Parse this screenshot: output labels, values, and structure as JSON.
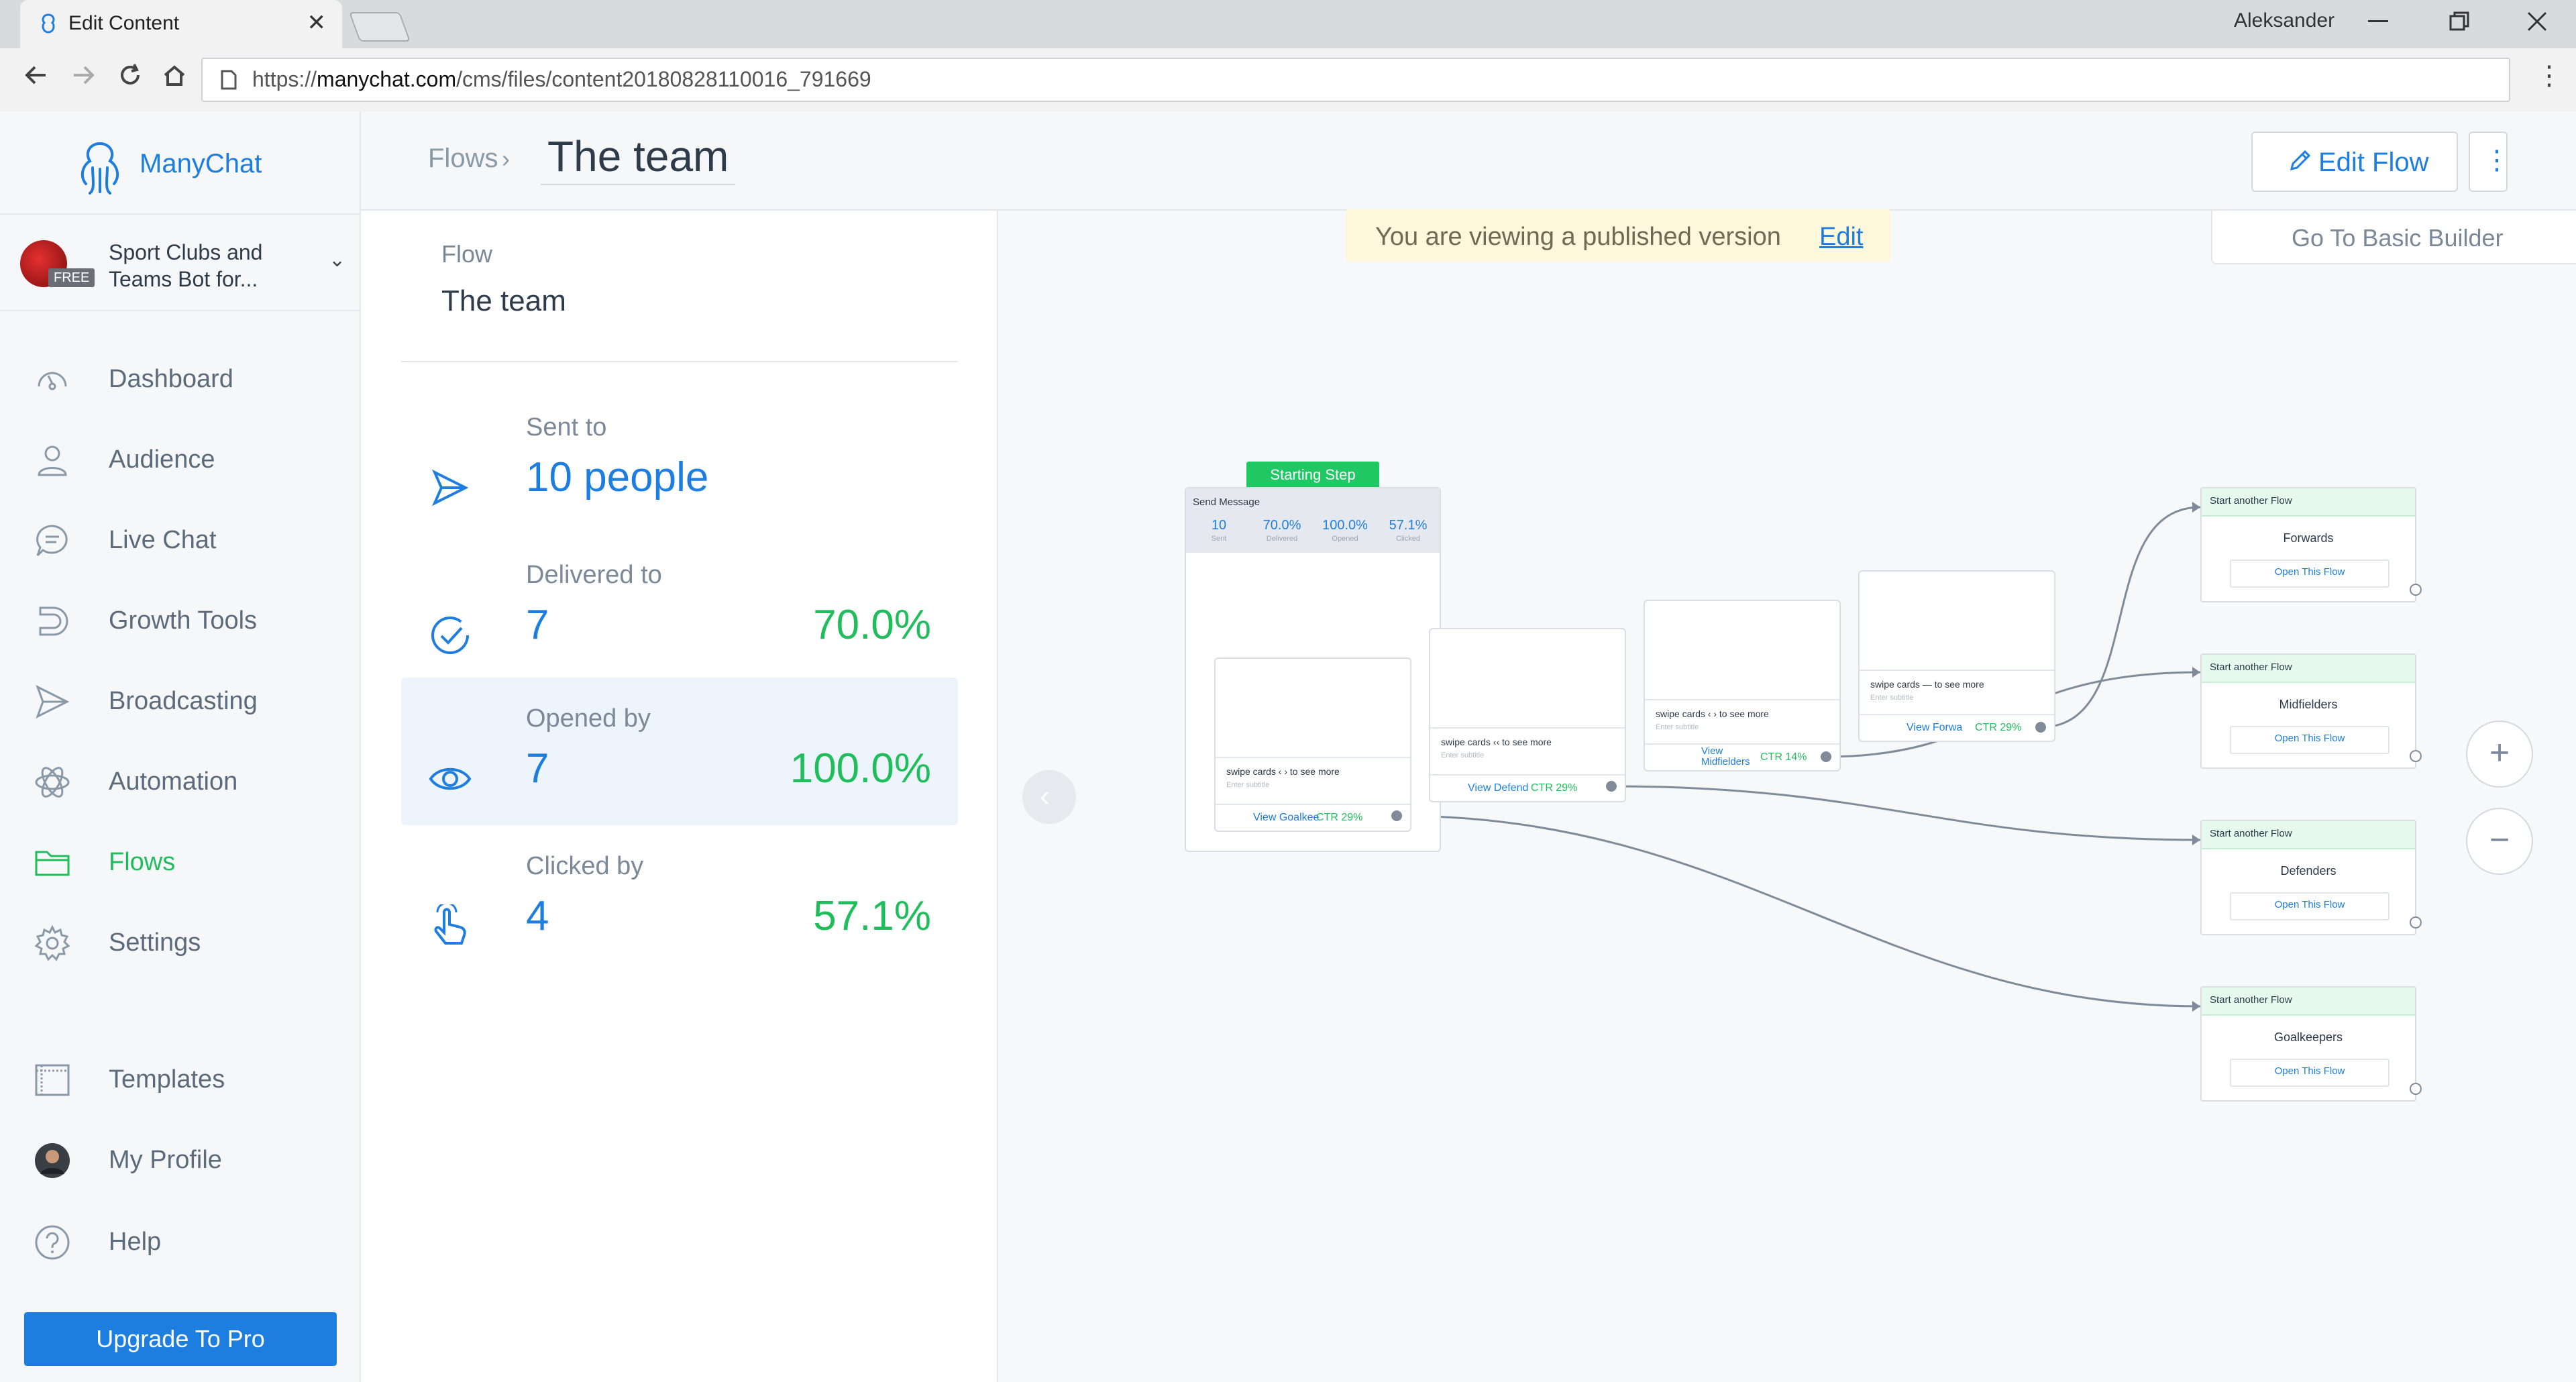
{
  "browser": {
    "tab_title": "Edit Content",
    "tab_close": "✕",
    "user": "Aleksander",
    "url_prefix": "https://",
    "url_host": "manychat.com",
    "url_path": "/cms/files/content20180828110016_791669"
  },
  "app": {
    "logo_text": "ManyChat",
    "breadcrumb": "Flows",
    "title": "The team",
    "edit_flow_label": "Edit Flow",
    "kebab": "⋮"
  },
  "account": {
    "name": "Sport Clubs and Teams Bot for...",
    "badge": "FREE"
  },
  "sidebar": {
    "items": [
      {
        "label": "Dashboard"
      },
      {
        "label": "Audience"
      },
      {
        "label": "Live Chat"
      },
      {
        "label": "Growth Tools"
      },
      {
        "label": "Broadcasting"
      },
      {
        "label": "Automation"
      },
      {
        "label": "Flows"
      },
      {
        "label": "Settings"
      },
      {
        "label": "Templates"
      },
      {
        "label": "My Profile"
      },
      {
        "label": "Help"
      }
    ],
    "upgrade_label": "Upgrade To Pro",
    "active_color": "#1fbd5b"
  },
  "stats": {
    "flow_label": "Flow",
    "flow_name": "The team",
    "items": [
      {
        "label": "Sent to",
        "value": "10 people",
        "percent": ""
      },
      {
        "label": "Delivered to",
        "value": "7",
        "percent": "70.0%"
      },
      {
        "label": "Opened by",
        "value": "7",
        "percent": "100.0%"
      },
      {
        "label": "Clicked by",
        "value": "4",
        "percent": "57.1%"
      }
    ]
  },
  "canvas": {
    "published_text": "You are viewing a published version",
    "published_link": "Edit",
    "basic_builder": "Go To Basic Builder",
    "starting_step": "Starting Step",
    "send_message": {
      "title": "Send Message",
      "stats": [
        {
          "value": "10",
          "label": "Sent"
        },
        {
          "value": "70.0%",
          "label": "Delivered"
        },
        {
          "value": "100.0%",
          "label": "Opened"
        },
        {
          "value": "57.1%",
          "label": "Clicked"
        }
      ]
    },
    "cards": [
      {
        "title": "swipe cards ‹ › to see more",
        "subtitle": "Enter subtitle",
        "button": "View Goalkee",
        "ctr": "CTR 29%"
      },
      {
        "title": "swipe cards ‹‹ to see more",
        "subtitle": "Enter subtitle",
        "button": "View Defend",
        "ctr": "CTR 29%"
      },
      {
        "title": "swipe cards ‹ › to see more",
        "subtitle": "Enter subtitle",
        "button": "View Midfielders",
        "ctr": "CTR 14%"
      },
      {
        "title": "swipe cards — to see more",
        "subtitle": "Enter subtitle",
        "button": "View Forwa",
        "ctr": "CTR 29%"
      }
    ],
    "flows": [
      {
        "header": "Start another Flow",
        "name": "Forwards",
        "button": "Open This Flow"
      },
      {
        "header": "Start another Flow",
        "name": "Midfielders",
        "button": "Open This Flow"
      },
      {
        "header": "Start another Flow",
        "name": "Defenders",
        "button": "Open This Flow"
      },
      {
        "header": "Start another Flow",
        "name": "Goalkeepers",
        "button": "Open This Flow"
      }
    ],
    "zoom_in": "+",
    "zoom_out": "−",
    "collapse": "‹"
  }
}
